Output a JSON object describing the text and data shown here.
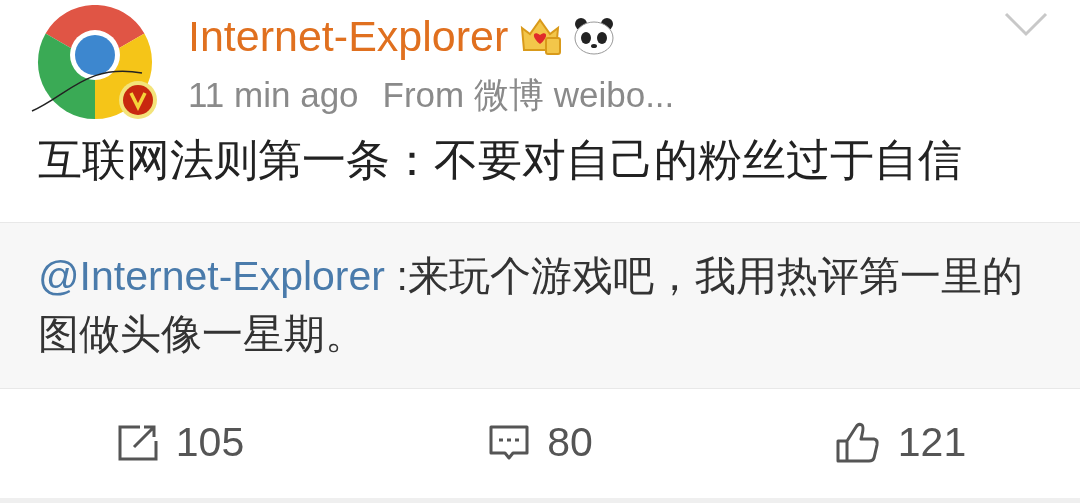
{
  "post": {
    "author": "Internet-Explorer",
    "time": "11 min ago",
    "source": "From 微博 weibo...",
    "text": "互联网法则第一条：不要对自己的粉丝过于自信"
  },
  "quote": {
    "mention": "@Internet-Explorer",
    "text": " :来玩个游戏吧，我用热评第一里的图做头像一星期。"
  },
  "actions": [
    {
      "kind": "repost",
      "count": "105"
    },
    {
      "kind": "comment",
      "count": "80"
    },
    {
      "kind": "like",
      "count": "121"
    }
  ]
}
